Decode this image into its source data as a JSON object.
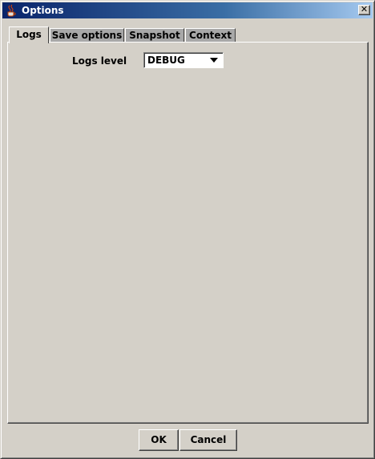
{
  "window": {
    "title": "Options",
    "close_glyph": "✕"
  },
  "tabs": [
    {
      "label": "Logs",
      "active": true
    },
    {
      "label": "Save options",
      "active": false
    },
    {
      "label": "Snapshot",
      "active": false
    },
    {
      "label": "Context",
      "active": false
    }
  ],
  "logs": {
    "level_label": "Logs level",
    "level_value": "DEBUG"
  },
  "buttons": {
    "ok": "OK",
    "cancel": "Cancel"
  },
  "icons": {
    "title_icon": "java-cup-icon",
    "dropdown": "chevron-down-icon",
    "close": "close-icon"
  }
}
